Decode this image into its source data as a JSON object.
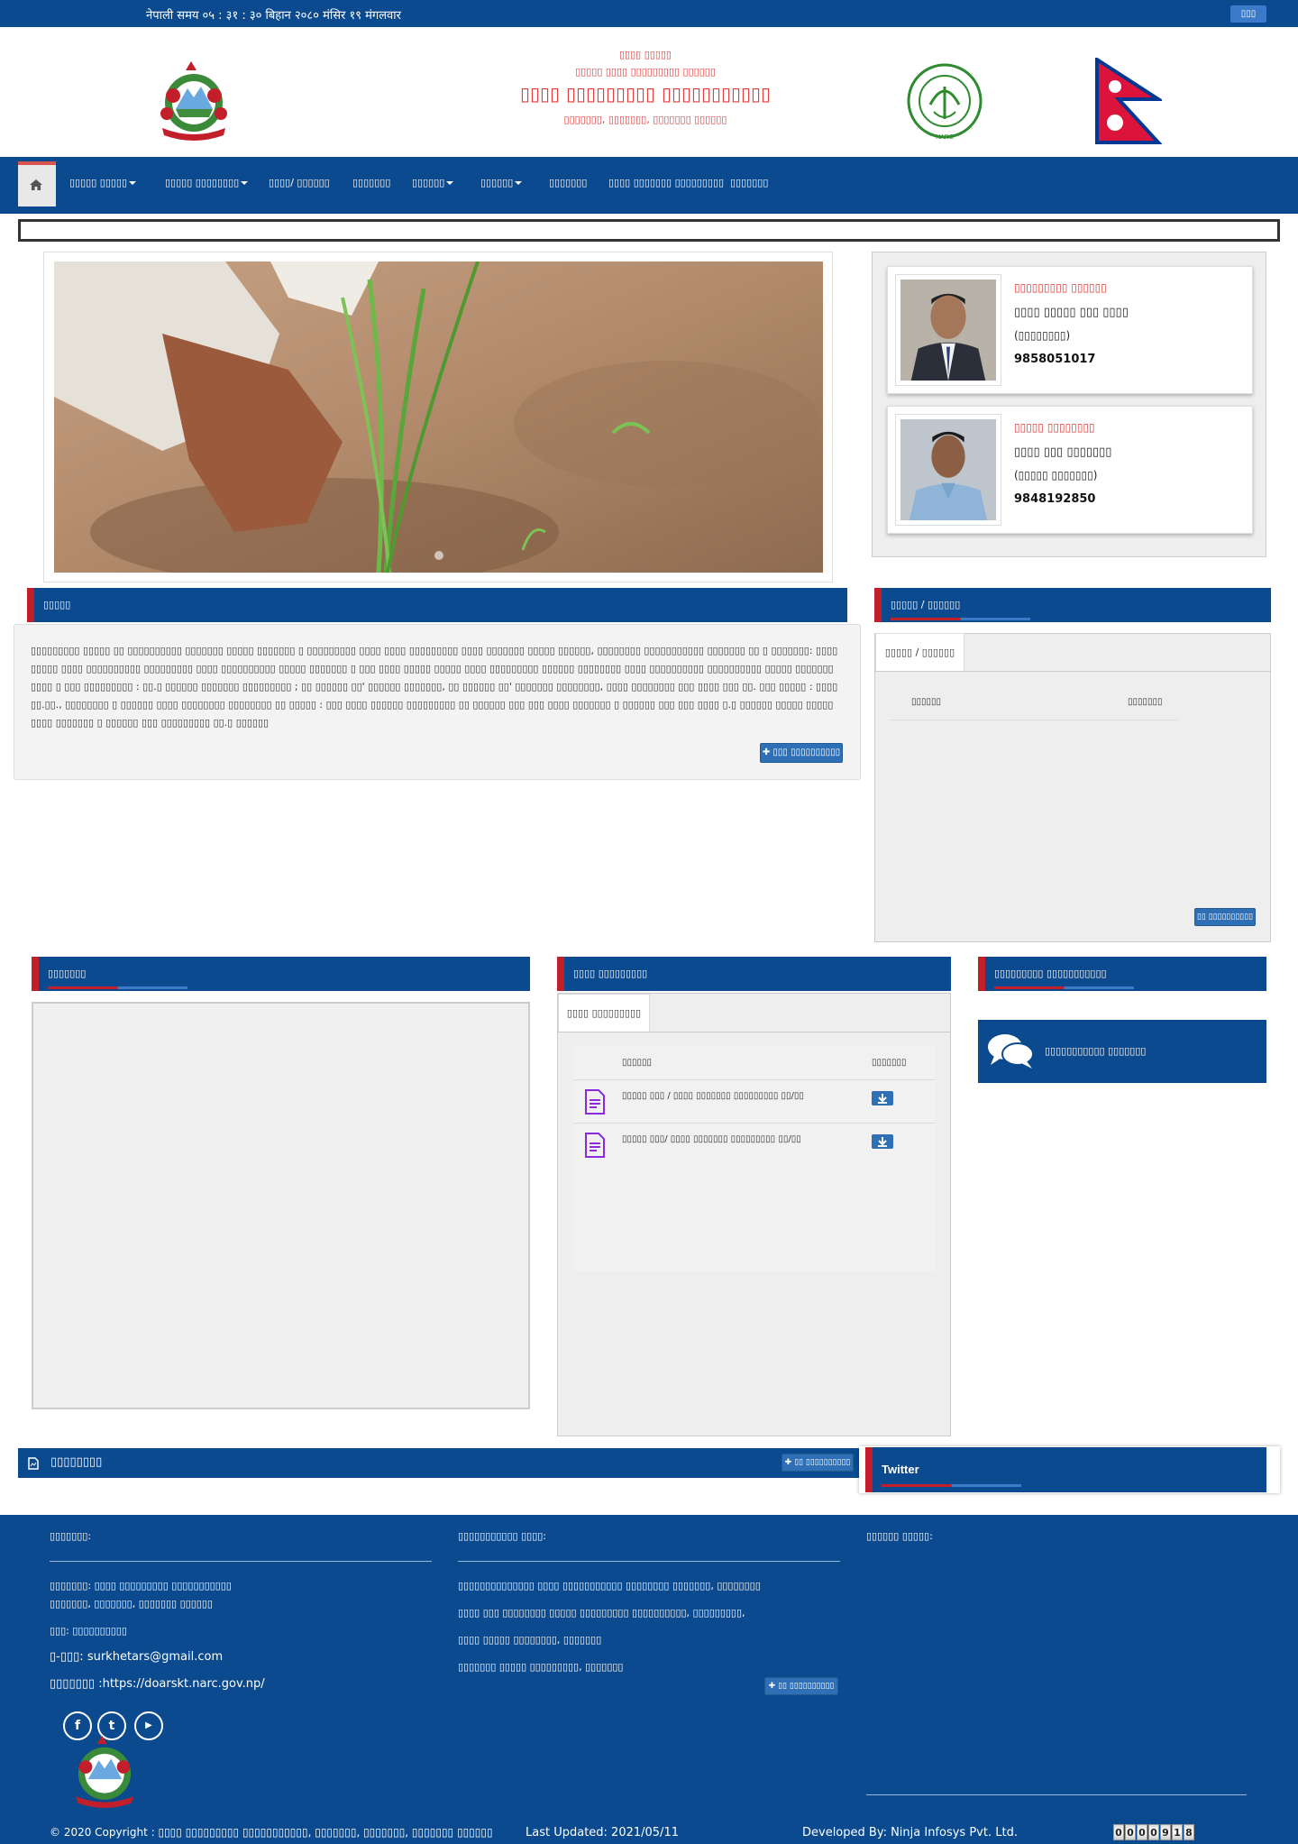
{
  "topbar": {
    "time_text": "नेपाली समय ०५ : ३१ : ३० बिहान   २०८० मंसिर १९ मंगलवार",
    "lang_button": "▯▯▯"
  },
  "header": {
    "line1": "▯▯▯▯ ▯▯▯▯▯",
    "line2": "▯▯▯▯▯ ▯▯▯▯ ▯▯▯▯▯▯▯▯▯ ▯▯▯▯▯▯",
    "line3": "▯▯▯▯ ▯▯▯▯▯▯▯▯▯ ▯▯▯▯▯▯▯▯▯▯▯",
    "line4": "▯▯▯▯▯▯▯, ▯▯▯▯▯▯▯, ▯▯▯▯▯▯▯ ▯▯▯▯▯▯",
    "narc_label": "NARC"
  },
  "nav": {
    "items": [
      {
        "label": "▯▯▯▯▯ ▯▯▯▯▯",
        "dropdown": true
      },
      {
        "label": "▯▯▯▯▯ ▯▯▯▯▯▯▯▯",
        "dropdown": true
      },
      {
        "label": "▯▯▯▯/ ▯▯▯▯▯▯",
        "dropdown": false
      },
      {
        "label": "▯▯▯▯▯▯▯",
        "dropdown": false
      },
      {
        "label": "▯▯▯▯▯▯",
        "dropdown": true
      },
      {
        "label": "▯▯▯▯▯▯",
        "dropdown": true
      },
      {
        "label": "▯▯▯▯▯▯▯",
        "dropdown": false
      },
      {
        "label": "▯▯▯▯ ▯▯▯▯▯▯▯ ▯▯▯▯▯▯▯▯▯",
        "dropdown": false
      },
      {
        "label": "▯▯▯▯▯▯▯",
        "dropdown": false
      }
    ]
  },
  "staff": [
    {
      "role": "▯▯▯▯▯▯▯▯▯ ▯▯▯▯▯▯",
      "name": "▯▯▯▯ ▯▯▯▯▯ ▯▯▯ ▯▯▯▯",
      "post": "(▯▯▯▯▯▯▯▯)",
      "phone": "9858051017"
    },
    {
      "role": "▯▯▯▯▯ ▯▯▯▯▯▯▯▯",
      "name": "▯▯▯▯ ▯▯▯ ▯▯▯▯▯▯▯",
      "post": "(▯▯▯▯▯ ▯▯▯▯▯▯▯)",
      "phone": "9848192850"
    }
  ],
  "about": {
    "heading": "▯▯▯▯▯",
    "text": "▯▯▯▯▯▯▯▯▯ ▯▯▯▯▯ ▯▯ ▯▯▯▯▯▯▯▯▯▯ ▯▯▯▯▯▯▯ ▯▯▯▯▯ ▯▯▯▯▯▯▯ ▯ ▯▯▯▯▯▯▯▯▯ ▯▯▯▯ ▯▯▯▯ ▯▯▯▯▯▯▯▯▯ ▯▯▯▯ ▯▯▯▯▯▯▯ ▯▯▯▯▯ ▯▯▯▯▯▯, ▯▯▯▯▯▯▯▯ ▯▯▯▯▯▯▯▯▯▯▯ ▯▯▯▯▯▯▯ ▯▯ ▯ ▯▯▯▯▯▯▯: ▯▯▯▯ ▯▯▯▯▯ ▯▯▯▯ ▯▯▯▯▯▯▯▯▯▯ ▯▯▯▯▯▯▯▯▯ ▯▯▯▯ ▯▯▯▯▯▯▯▯▯▯ ▯▯▯▯▯ ▯▯▯▯▯▯▯ ▯ ▯▯▯ ▯▯▯▯ ▯▯▯▯▯ ▯▯▯▯▯ ▯▯▯▯ ▯▯▯▯▯▯▯▯▯ ▯▯▯▯▯▯ ▯▯▯▯▯▯▯▯ ▯▯▯▯ ▯▯▯▯▯▯▯▯▯▯ ▯▯▯▯▯▯▯▯▯▯ ▯▯▯▯▯ ▯▯▯▯▯▯▯ ▯▯▯▯ ▯ ▯▯▯ ▯▯▯▯▯▯▯▯▯ : ▯▯.▯ ▯▯▯▯▯▯ ▯▯▯▯▯▯▯ ▯▯▯▯▯▯▯▯▯ ; ▯▯ ▯▯▯▯▯▯ ▯▯' ▯▯▯▯▯▯ ▯▯▯▯▯▯▯, ▯▯ ▯▯▯▯▯▯ ▯▯' ▯▯▯▯▯▯▯ ▯▯▯▯▯▯▯▯, ▯▯▯▯ ▯▯▯▯▯▯▯▯ ▯▯▯ ▯▯▯▯ ▯▯▯ ▯▯. ▯▯▯ ▯▯▯▯▯ : ▯▯▯▯ ▯▯.▯▯., ▯▯▯▯▯▯▯▯ ▯ ▯▯▯▯▯▯ ▯▯▯▯ ▯▯▯▯▯▯▯▯ ▯▯▯▯▯▯▯▯ ▯▯ ▯▯▯▯▯ : ▯▯▯ ▯▯▯▯ ▯▯▯▯▯▯ ▯▯▯▯▯▯▯▯▯ ▯▯ ▯▯▯▯▯▯ ▯▯▯ ▯▯▯ ▯▯▯▯ ▯▯▯▯▯▯▯ ▯ ▯▯▯▯▯▯ ▯▯▯ ▯▯▯ ▯▯▯▯ ▯.▯ ▯▯▯▯▯▯ ▯▯▯▯▯ ▯▯▯▯▯ ▯▯▯▯ ▯▯▯▯▯▯▯ ▯ ▯▯▯▯▯▯ ▯▯▯ ▯▯▯▯▯▯▯▯▯ ▯▯.▯ ▯▯▯▯▯▯",
    "more_button": "▯▯▯ ▯▯▯▯▯▯▯▯▯▯"
  },
  "news": {
    "heading": "▯▯▯▯▯ / ▯▯▯▯▯▯",
    "tab": "▯▯▯▯▯ / ▯▯▯▯▯▯",
    "col1": "▯▯▯▯▯▯",
    "col2": "▯▯▯▯▯▯▯",
    "more_button": "▯▯ ▯▯▯▯▯▯▯▯▯▯"
  },
  "gallery": {
    "heading": "▯▯▯▯▯▯▯"
  },
  "publications": {
    "heading": "▯▯▯▯ ▯▯▯▯▯▯▯▯▯",
    "tab": "▯▯▯▯ ▯▯▯▯▯▯▯▯▯",
    "col1": "▯▯▯▯▯▯",
    "col2": "▯▯▯▯▯▯▯",
    "rows": [
      {
        "title": "▯▯▯▯▯ ▯▯▯ / ▯▯▯▯ ▯▯▯▯▯▯▯ ▯▯▯▯▯▯▯▯▯ ▯▯/▯▯"
      },
      {
        "title": "▯▯▯▯▯ ▯▯▯/ ▯▯▯▯ ▯▯▯▯▯▯▯ ▯▯▯▯▯▯▯▯▯ ▯▯/▯▯"
      }
    ]
  },
  "feedback": {
    "heading": "▯▯▯▯▯▯▯▯▯ ▯▯▯▯▯▯▯▯▯▯▯",
    "label": "▯▯▯▯▯▯▯▯▯▯▯ ▯▯▯▯▯▯▯"
  },
  "downloads": {
    "heading": "▯▯▯▯▯▯▯▯",
    "more_button": "▯▯ ▯▯▯▯▯▯▯▯▯▯"
  },
  "twitter": {
    "heading": "Twitter"
  },
  "footer": {
    "contact_title": "▯▯▯▯▯▯▯:",
    "office": "▯▯▯▯▯▯▯: ▯▯▯▯ ▯▯▯▯▯▯▯▯▯ ▯▯▯▯▯▯▯▯▯▯▯",
    "address": "▯▯▯▯▯▯▯, ▯▯▯▯▯▯▯, ▯▯▯▯▯▯▯ ▯▯▯▯▯▯",
    "phone": "▯▯▯: ▯▯▯▯▯▯▯▯▯▯",
    "email": "▯-▯▯▯: surkhetars@gmail.com",
    "website": "▯▯▯▯▯▯▯ :https://doarskt.narc.gov.np/",
    "links_title": "▯▯▯▯▯▯▯▯▯▯▯ ▯▯▯▯:",
    "links": [
      "▯▯▯▯▯▯▯▯▯▯▯▯▯▯ ▯▯▯▯ ▯▯▯▯▯▯▯▯▯▯▯ ▯▯▯▯▯▯▯▯ ▯▯▯▯▯▯▯, ▯▯▯▯▯▯▯▯",
      "▯▯▯▯ ▯▯▯ ▯▯▯▯▯▯▯▯ ▯▯▯▯▯ ▯▯▯▯▯▯▯▯▯ ▯▯▯▯▯▯▯▯▯▯, ▯▯▯▯▯▯▯▯▯,",
      "▯▯▯▯ ▯▯▯▯▯ ▯▯▯▯▯▯▯▯, ▯▯▯▯▯▯▯",
      "▯▯▯▯▯▯▯ ▯▯▯▯▯ ▯▯▯▯▯▯▯▯▯, ▯▯▯▯▯▯▯"
    ],
    "links_more": "▯▯ ▯▯▯▯▯▯▯▯▯▯",
    "third_title": "▯▯▯▯▯▯ ▯▯▯▯▯:",
    "copyright": "© 2020 Copyright : ▯▯▯▯ ▯▯▯▯▯▯▯▯▯ ▯▯▯▯▯▯▯▯▯▯▯, ▯▯▯▯▯▯▯, ▯▯▯▯▯▯▯, ▯▯▯▯▯▯▯ ▯▯▯▯▯▯",
    "last_updated": "Last Updated: 2021/05/11",
    "developer": "Developed By: Ninja Infosys Pvt. Ltd.",
    "counter": [
      "0",
      "0",
      "0",
      "0",
      "9",
      "1",
      "8"
    ]
  },
  "colors": {
    "primary": "#0b4a8f",
    "accent_red": "#c21f2b",
    "header_red": "#e03a3a"
  }
}
